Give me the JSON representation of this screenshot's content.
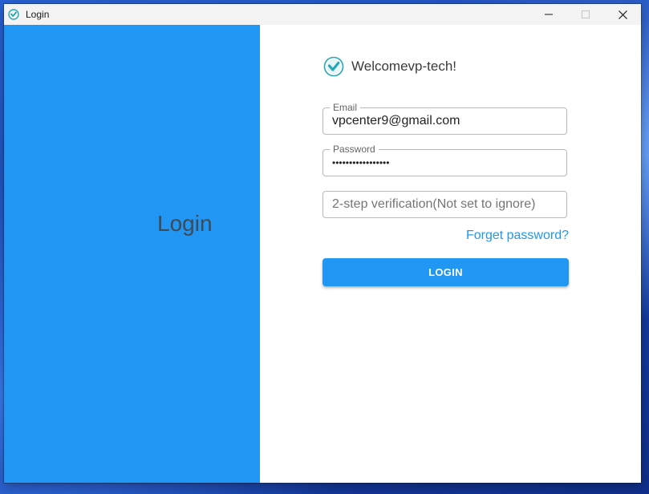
{
  "window": {
    "title": "Login",
    "controls": {
      "minimize": "minimize",
      "maximize": "maximize",
      "close": "close"
    }
  },
  "left_panel": {
    "title": "Login",
    "background": "#2196f3"
  },
  "form": {
    "welcome": "Welcomevp-tech!",
    "email": {
      "label": "Email",
      "value": "vpcenter9@gmail.com"
    },
    "password": {
      "label": "Password",
      "masked_value": "•••••••••••••••••"
    },
    "two_step": {
      "placeholder": "2-step verification(Not set to ignore)"
    },
    "forgot_password": "Forget password?",
    "login_button": "LOGIN"
  },
  "colors": {
    "accent": "#2196f3",
    "logo": "#26a7b5"
  }
}
